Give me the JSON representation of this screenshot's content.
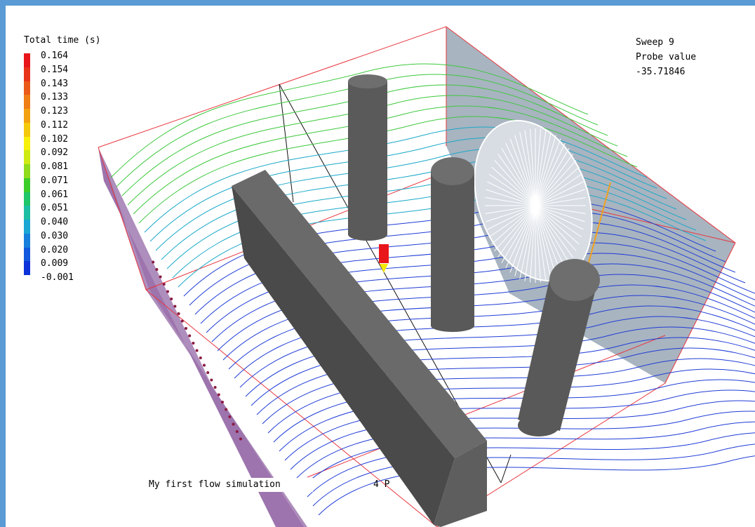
{
  "app": {
    "frame_color": "#5b9bd5",
    "background": "#ffffff"
  },
  "legend": {
    "title": "Total time (s)",
    "labels": [
      "0.164",
      "0.154",
      "0.143",
      "0.133",
      "0.123",
      "0.112",
      "0.102",
      "0.092",
      "0.081",
      "0.071",
      "0.061",
      "0.051",
      "0.040",
      "0.030",
      "0.020",
      "0.009",
      "-0.001"
    ],
    "colors": [
      "#e8161b",
      "#e8341a",
      "#ea5a18",
      "#ef7e14",
      "#f2a10f",
      "#f5c90b",
      "#f7f00a",
      "#cdea12",
      "#8fdb1c",
      "#3ccd2a",
      "#1fc66a",
      "#1cbfa4",
      "#1aa7d4",
      "#1680dc",
      "#1159dd",
      "#0c32da",
      "#0a12d6"
    ]
  },
  "readout": {
    "sweep": "Sweep 9",
    "probe_label": "Probe value",
    "probe_value": "-35.71846"
  },
  "caption": {
    "title": "My first flow simulation",
    "suffix": "4 P"
  },
  "scene": {
    "streamline_colors": {
      "low": "#1e3cd6",
      "mid": "#19a8c8",
      "high": "#3cc83c"
    },
    "box_edge_color": "#e8343c",
    "obstacle_color": "#5a5a5a",
    "inlet_panel_color": "#a07ab0",
    "outlet_panel_color": "#a8b4c0",
    "probe_stem_color": "#f0a020"
  }
}
